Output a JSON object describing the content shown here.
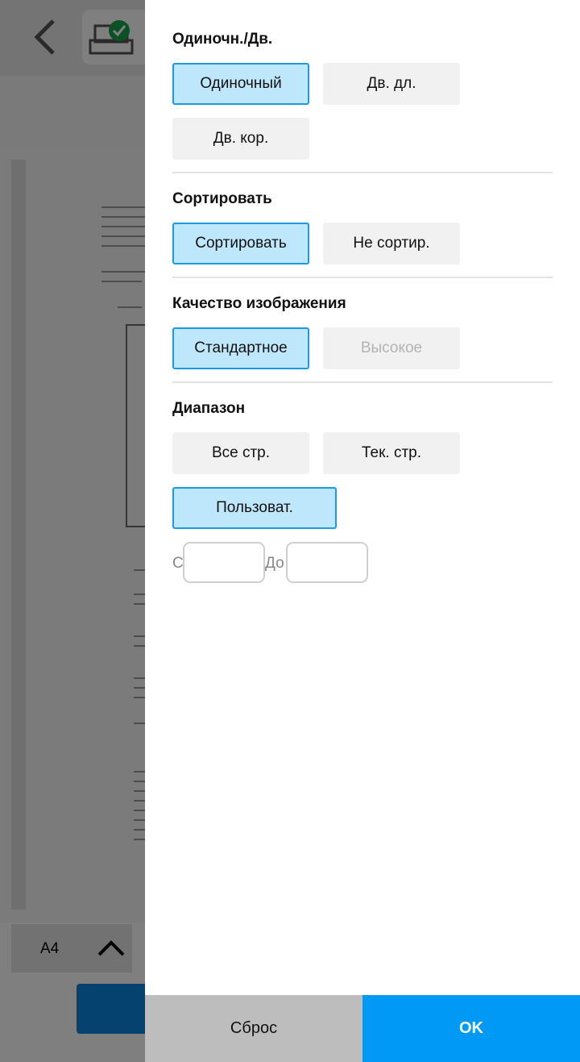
{
  "background": {
    "paper_size": "A4"
  },
  "sections": {
    "sides": {
      "title": "Одиночн./Дв.",
      "options": [
        "Одиночный",
        "Дв. дл.",
        "Дв. кор."
      ],
      "selected": "Одиночный"
    },
    "collate": {
      "title": "Сортировать",
      "options": [
        "Сортировать",
        "Не сортир."
      ],
      "selected": "Сортировать"
    },
    "quality": {
      "title": "Качество изображения",
      "options": [
        "Стандартное",
        "Высокое"
      ],
      "selected": "Стандартное",
      "disabled": [
        "Высокое"
      ]
    },
    "range": {
      "title": "Диапазон",
      "options": [
        "Все стр.",
        "Тек. стр.",
        "Пользоват."
      ],
      "selected": "Пользоват.",
      "from_label": "С",
      "to_label": "До",
      "from_value": "",
      "to_value": ""
    }
  },
  "footer": {
    "reset_label": "Сброс",
    "ok_label": "OK"
  },
  "colors": {
    "selected_fill": "#bfe7fb",
    "selected_border": "#1a9ae8",
    "ok_button": "#0099f5",
    "reset_button": "#bdbdbd"
  }
}
